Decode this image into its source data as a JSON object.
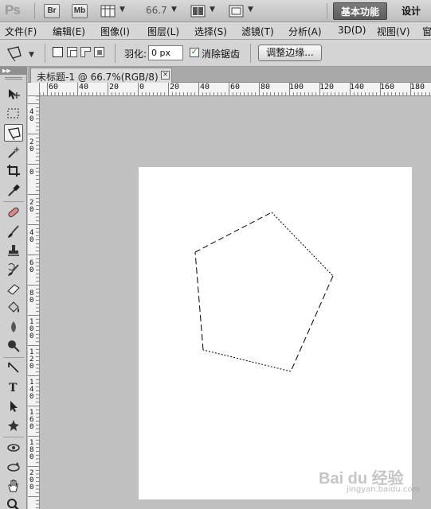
{
  "app": {
    "logo": "Ps",
    "bridge_button": "Br",
    "minibridge_button": "Mb",
    "zoom": "66.7",
    "workspaces": {
      "active": "基本功能",
      "other": "设计"
    }
  },
  "menu": [
    "文件(F)",
    "编辑(E)",
    "图像(I)",
    "图层(L)",
    "选择(S)",
    "滤镜(T)",
    "分析(A)",
    "3D(D)",
    "视图(V)",
    "窗"
  ],
  "options": {
    "feather_label": "羽化:",
    "feather_value": "0 px",
    "antialias_checked": "✓",
    "antialias_label": "消除锯齿",
    "refine_edge_button": "调整边缘..."
  },
  "document": {
    "tab_title": "未标题-1 @ 66.7%(RGB/8)",
    "close_symbol": "×"
  },
  "rulers": {
    "horizontal": [
      "60",
      "40",
      "20",
      "0",
      "20",
      "40",
      "60",
      "80",
      "100",
      "120",
      "140",
      "160",
      "180"
    ],
    "vertical": [
      "4\n0",
      "2\n0",
      "0",
      "2\n0",
      "4\n0",
      "6\n0",
      "8\n0",
      "1\n0\n0",
      "1\n2\n0",
      "1\n4\n0",
      "1\n6\n0",
      "1\n8\n0",
      "2\n0\n0"
    ]
  },
  "tools": [
    "move-tool",
    "marquee-tool",
    "polygonal-lasso-tool",
    "magic-wand-tool",
    "crop-tool",
    "eyedropper-tool",
    "spot-healing-tool",
    "brush-tool",
    "clone-stamp-tool",
    "history-brush-tool",
    "eraser-tool",
    "paint-bucket-tool",
    "blur-tool",
    "dodge-tool",
    "pen-tool",
    "type-tool",
    "path-selection-tool",
    "custom-shape-tool",
    "3d-rotate-tool",
    "3d-orbit-tool",
    "hand-tool",
    "zoom-tool"
  ],
  "active_tool": "polygonal-lasso-tool",
  "watermark": {
    "main": "Bai du 经验",
    "sub": "jingyan.baidu.com"
  }
}
